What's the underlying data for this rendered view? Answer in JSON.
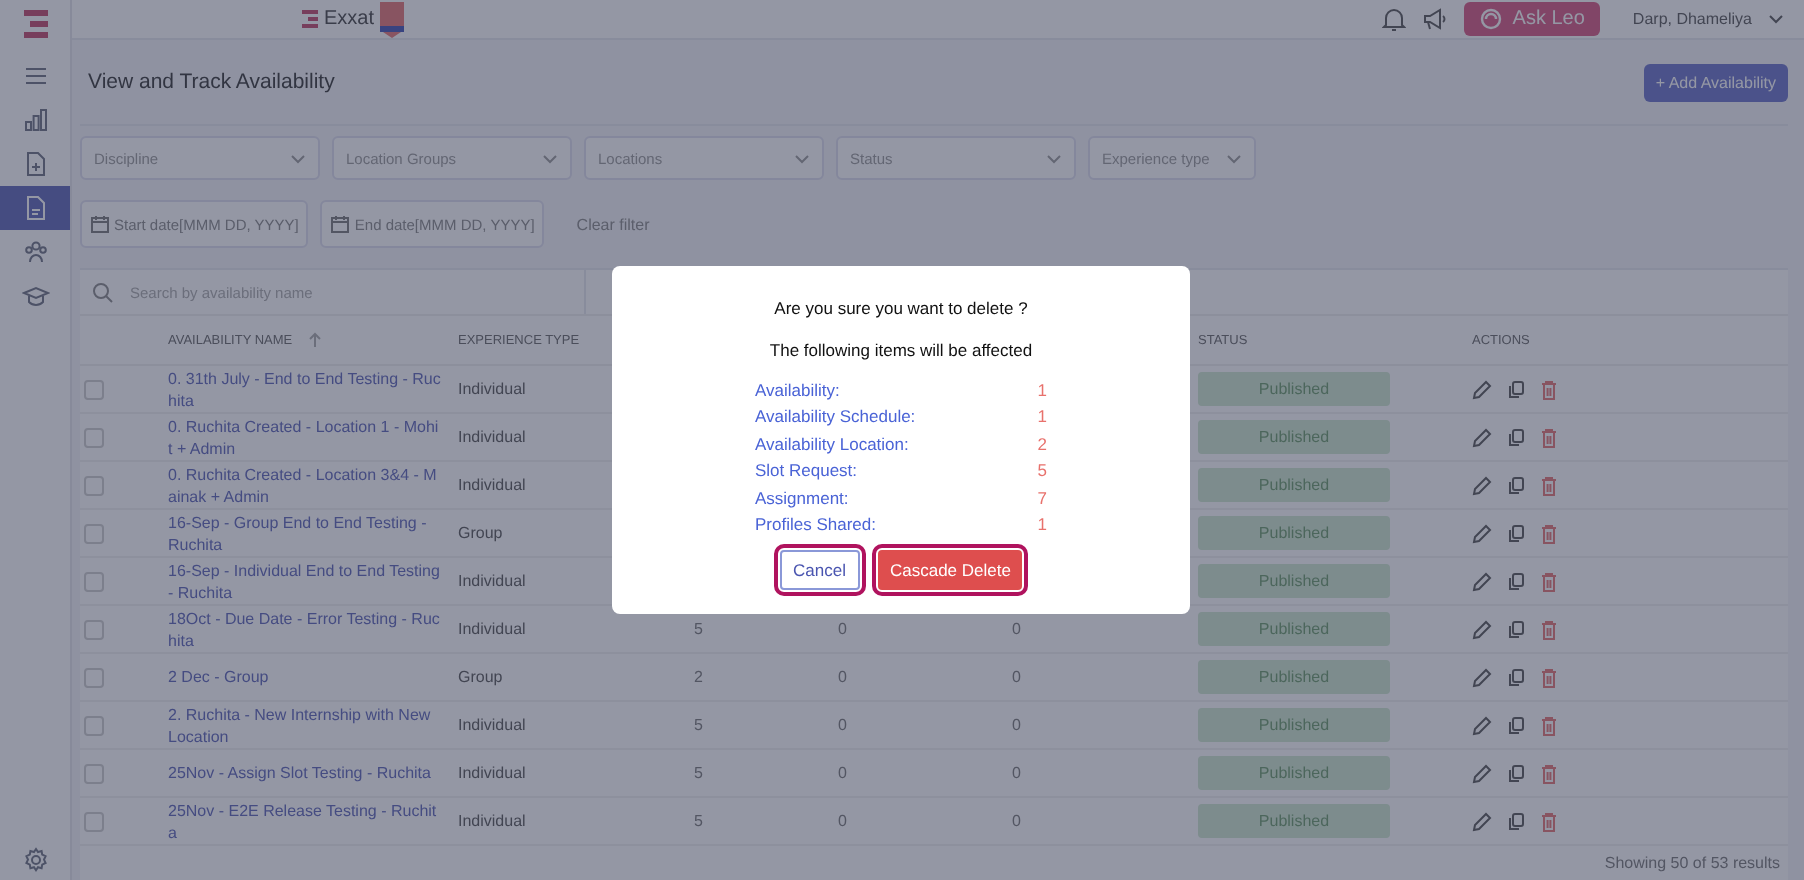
{
  "topbar": {
    "brand": "Exxat",
    "ask_button": "Ask Leo",
    "user": "Darp, Dhameliya"
  },
  "sidebar": {
    "items": [
      {
        "kind": "menu",
        "selected": false
      },
      {
        "kind": "chart",
        "selected": false
      },
      {
        "kind": "file-plus",
        "selected": false
      },
      {
        "kind": "document",
        "selected": true
      },
      {
        "kind": "people",
        "selected": false
      },
      {
        "kind": "graduation",
        "selected": false
      }
    ]
  },
  "page_title": "View and Track Availability",
  "add_button": "+ Add Availability",
  "filters": [
    "Discipline",
    "Location Groups",
    "Locations",
    "Status",
    "Experience type"
  ],
  "date_filters": [
    "Start date[MMM DD, YYYY]",
    "End date[MMM DD, YYYY]"
  ],
  "clear_filter": "Clear filter",
  "search": {
    "placeholder": "Search by availability name"
  },
  "table": {
    "columns": [
      {
        "label": "AVAILABILITY NAME",
        "sorted": true
      },
      {
        "label": "EXPERIENCE TYPE",
        "sorted": false
      },
      {
        "label": "STATUS",
        "sorted": false
      },
      {
        "label": "ACTIONS",
        "sorted": false
      }
    ],
    "rows": [
      {
        "checked": false,
        "name": "0. 31th July - End to End Testing - Ruchita",
        "experience_type": "Individual",
        "status": "Published"
      },
      {
        "checked": false,
        "name": "0. Ruchita Created - Location 1 - Mohit + Admin",
        "experience_type": "Individual",
        "status": "Published"
      },
      {
        "checked": false,
        "name": "0. Ruchita Created - Location 3&4 - Mainak + Admin",
        "experience_type": "Individual",
        "status": "Published"
      },
      {
        "checked": false,
        "name": "16-Sep - Group End to End Testing - Ruchita",
        "experience_type": "Group",
        "status": "Published"
      },
      {
        "checked": false,
        "name": "16-Sep - Individual End to End Testing - Ruchita",
        "experience_type": "Individual",
        "status": "Published"
      },
      {
        "checked": false,
        "name": "18Oct - Due Date - Error Testing - Ruchita",
        "experience_type": "Individual",
        "column_3": "5",
        "column_4": "0",
        "column_5": "0",
        "status": "Published"
      },
      {
        "checked": false,
        "name": "2 Dec - Group",
        "experience_type": "Group",
        "column_3": "2",
        "column_4": "0",
        "column_5": "0",
        "status": "Published"
      },
      {
        "checked": false,
        "name": "2. Ruchita - New Internship with New Location",
        "experience_type": "Individual",
        "column_3": "5",
        "column_4": "0",
        "column_5": "0",
        "status": "Published"
      },
      {
        "checked": false,
        "name": "25Nov - Assign Slot Testing - Ruchita",
        "experience_type": "Individual",
        "column_3": "5",
        "column_4": "0",
        "column_5": "0",
        "status": "Published"
      },
      {
        "checked": false,
        "name": "25Nov - E2E Release Testing - Ruchita",
        "experience_type": "Individual",
        "column_3": "5",
        "column_4": "0",
        "column_5": "0",
        "status": "Published"
      }
    ]
  },
  "results": "Showing 50 of 53 results",
  "dialog": {
    "title": "Are you sure you want to delete ?",
    "subtitle": "The following items will be affected",
    "items": [
      {
        "label": "Availability:",
        "count": "1"
      },
      {
        "label": "Availability Schedule:",
        "count": "1"
      },
      {
        "label": "Availability Location:",
        "count": "2"
      },
      {
        "label": "Slot Request:",
        "count": "5"
      },
      {
        "label": "Assignment:",
        "count": "7"
      },
      {
        "label": "Profiles Shared:",
        "count": "1"
      }
    ],
    "cancel": "Cancel",
    "confirm": "Cascade Delete"
  }
}
